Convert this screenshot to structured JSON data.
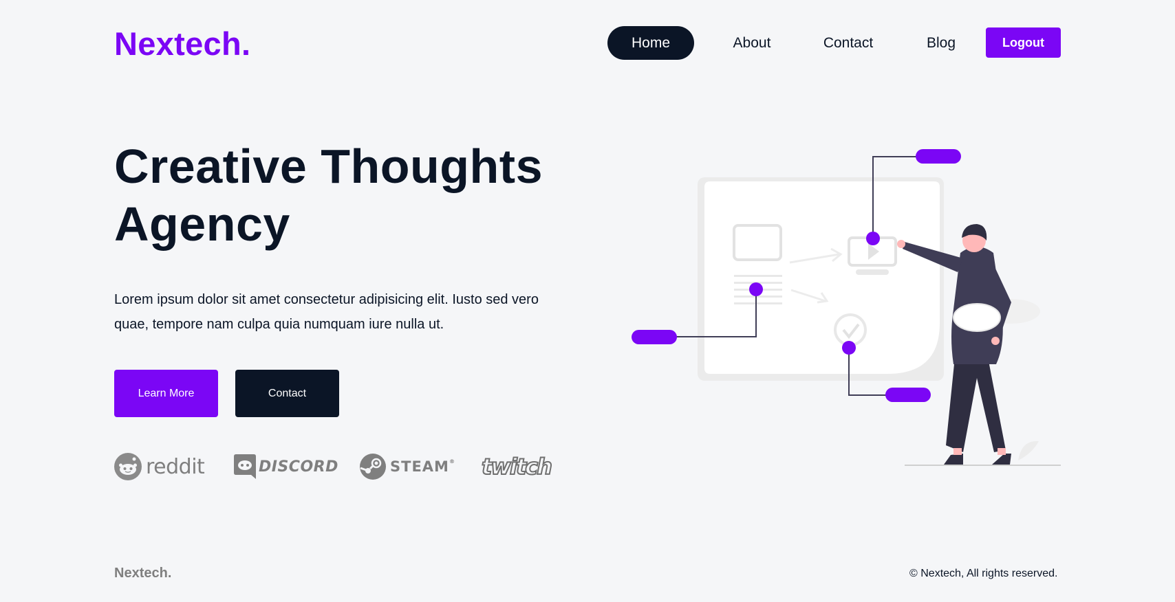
{
  "brand": {
    "logo": "Nextech."
  },
  "nav": {
    "items": [
      "Home",
      "About",
      "Contact",
      "Blog"
    ],
    "active": "Home",
    "logout_label": "Logout"
  },
  "hero": {
    "title": "Creative Thoughts Agency",
    "description": "Lorem ipsum dolor sit amet consectetur adipisicing elit. Iusto sed vero quae, tempore nam culpa quia numquam iure nulla ut.",
    "learn_more_label": "Learn More",
    "contact_label": "Contact"
  },
  "partners": {
    "reddit": "reddit",
    "discord": "DISCORD",
    "steam": "STEAM",
    "steam_mark": "®",
    "twitch": "twitch"
  },
  "footer": {
    "logo": "Nextech.",
    "copyright": "© Nextech, All rights reserved."
  },
  "colors": {
    "accent": "#7b06f5",
    "dark": "#0b1526",
    "background": "#f5f6f8",
    "muted": "#7f7f7f"
  },
  "icons": [
    "reddit-logo-icon",
    "discord-logo-icon",
    "steam-logo-icon",
    "twitch-logo-icon"
  ]
}
